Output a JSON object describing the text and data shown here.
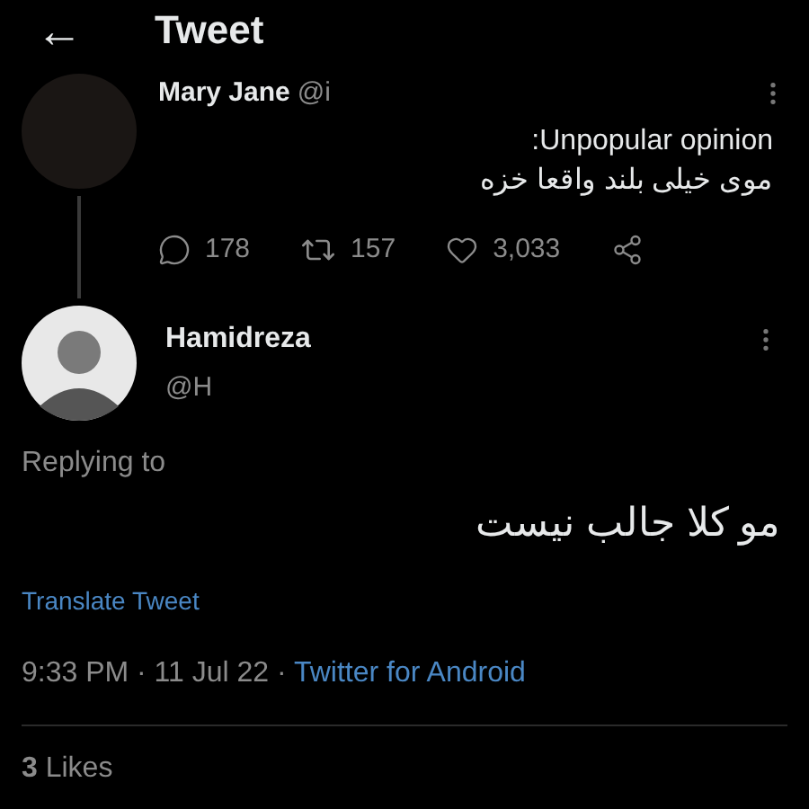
{
  "header": {
    "back_icon": "←",
    "title": "Tweet"
  },
  "parent_tweet": {
    "name": "Mary Jane",
    "handle": "@i",
    "text_lines": [
      ":Unpopular opinion",
      "موی خیلی بلند واقعا خزه"
    ],
    "actions": [
      {
        "kind": "reply",
        "count": "178"
      },
      {
        "kind": "retweet",
        "count": "157"
      },
      {
        "kind": "like",
        "count": "3,033"
      },
      {
        "kind": "share"
      }
    ]
  },
  "reply_tweet": {
    "name": "Hamidreza",
    "handle": "@H",
    "replying_to": "Replying to",
    "text": "مو کلا جالب نیست",
    "translate": "Translate Tweet",
    "time": "9:33 PM · 11 Jul 22 · ",
    "source": "Twitter for Android"
  },
  "likes": "**3** Likes"
}
